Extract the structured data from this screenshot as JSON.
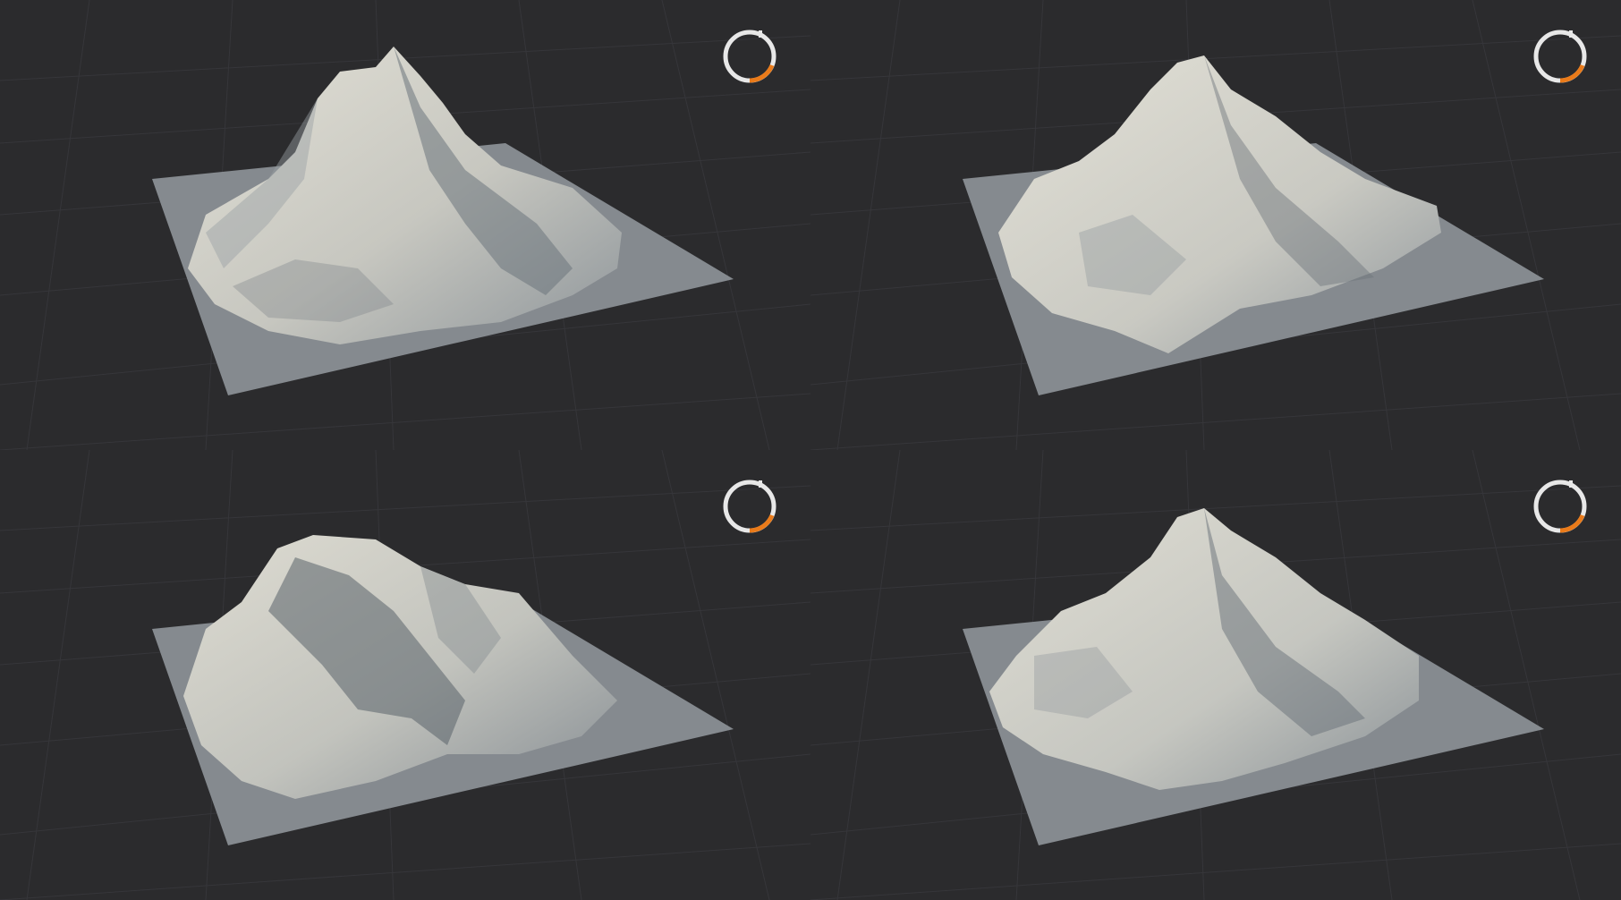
{
  "viewports": [
    {
      "id": "top-left",
      "terrain": "sharp-peak"
    },
    {
      "id": "top-right",
      "terrain": "pyramid-peak"
    },
    {
      "id": "bottom-left",
      "terrain": "split-ridge"
    },
    {
      "id": "bottom-right",
      "terrain": "tall-peak-wide-base"
    }
  ],
  "colors": {
    "background": "#2b2b2d",
    "grid_line": "#38383b",
    "ground_plane": "#858a8f",
    "terrain_light": "#d9d7cc",
    "terrain_mid": "#b4b6b2",
    "terrain_shadow": "#5e6770",
    "gizmo_ring": "#e8e8e8",
    "gizmo_accent": "#ea7b1a"
  },
  "icons": [
    "orientation-gizmo-icon"
  ]
}
